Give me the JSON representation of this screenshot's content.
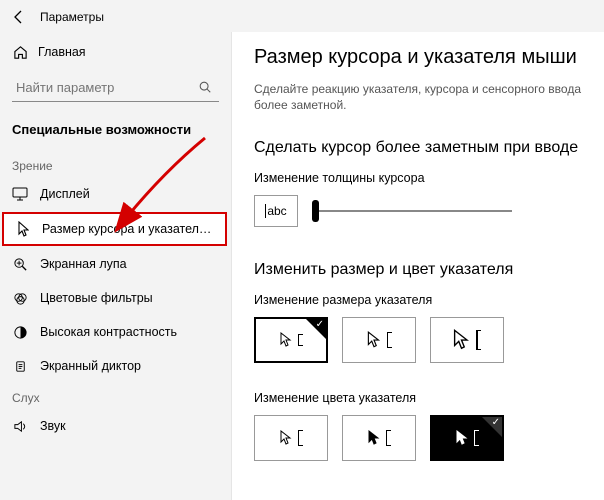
{
  "titlebar": {
    "title": "Параметры"
  },
  "sidebar": {
    "home": "Главная",
    "search_placeholder": "Найти параметр",
    "section": "Специальные возможности",
    "groups": [
      {
        "label": "Зрение",
        "items": [
          {
            "icon": "display-icon",
            "label": "Дисплей"
          },
          {
            "icon": "cursor-icon",
            "label": "Размер курсора и указателя мыши",
            "active": true
          },
          {
            "icon": "magnifier-icon",
            "label": "Экранная лупа"
          },
          {
            "icon": "color-filter-icon",
            "label": "Цветовые фильтры"
          },
          {
            "icon": "contrast-icon",
            "label": "Высокая контрастность"
          },
          {
            "icon": "narrator-icon",
            "label": "Экранный диктор"
          }
        ]
      },
      {
        "label": "Слух",
        "items": [
          {
            "icon": "audio-icon",
            "label": "Звук"
          }
        ]
      }
    ]
  },
  "content": {
    "heading": "Размер курсора и указателя мыши",
    "desc": "Сделайте реакцию указателя, курсора и сенсорного ввода более заметной.",
    "section1_title": "Сделать курсор более заметным при вводе",
    "thickness_label": "Изменение толщины курсора",
    "preview_text": "abc",
    "section2_title": "Изменить размер и цвет указателя",
    "size_label": "Изменение размера указателя",
    "color_label": "Изменение цвета указателя"
  }
}
